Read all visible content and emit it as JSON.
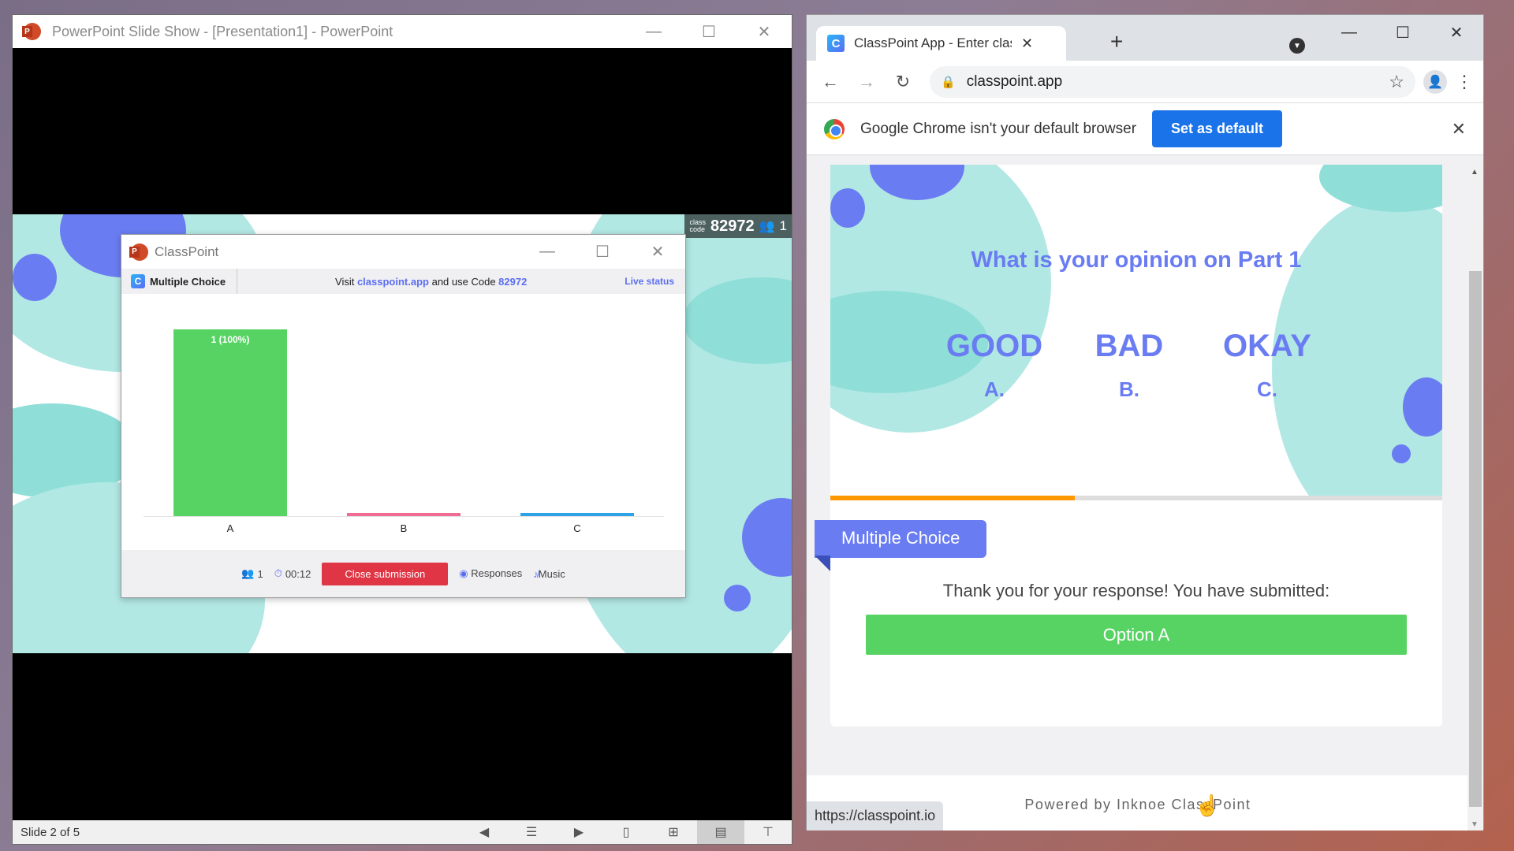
{
  "powerpoint": {
    "window_title": "PowerPoint Slide Show - [Presentation1] - PowerPoint",
    "window_controls": {
      "minimize": "—",
      "maximize": "☐",
      "close": "✕"
    },
    "class_code_badge": {
      "label_line1": "class",
      "label_line2": "code",
      "code": "82972",
      "participants": "1"
    },
    "status": {
      "slide_indicator": "Slide 2 of 5",
      "icons": [
        "previous-slide-icon",
        "notes-icon",
        "next-slide-icon",
        "normal-view-icon",
        "slide-sorter-icon",
        "reading-view-icon",
        "slideshow-icon"
      ],
      "active_view": "reading-view-icon"
    }
  },
  "classpoint_dialog": {
    "title": "ClassPoint",
    "question_type": "Multiple Choice",
    "visit_prefix": "Visit ",
    "visit_link": "classpoint.app",
    "visit_middle": " and use Code ",
    "visit_code": "82972",
    "live_status": "Live status",
    "footer": {
      "participants": "1",
      "timer": "00:12",
      "close_submission": "Close submission",
      "responses": "Responses",
      "music": "Music"
    }
  },
  "chart_data": {
    "type": "bar",
    "title": "",
    "xlabel": "",
    "ylabel": "",
    "categories": [
      "A",
      "B",
      "C"
    ],
    "values": [
      1,
      0,
      0
    ],
    "data_labels": [
      "1 (100%)",
      "",
      ""
    ],
    "colors": [
      "#57d364",
      "#f06b91",
      "#2ea3e8"
    ],
    "ylim": [
      0,
      1
    ],
    "grid": false,
    "legend": "none"
  },
  "chrome": {
    "tab_title": "ClassPoint App - Enter class code",
    "tab_close": "✕",
    "new_tab": "+",
    "url": "classpoint.app",
    "infobar": {
      "message": "Google Chrome isn't your default browser",
      "button": "Set as default",
      "close": "✕"
    },
    "status_url": "https://classpoint.io"
  },
  "web_page": {
    "slide": {
      "question": "What is your opinion on Part 1",
      "options": [
        {
          "text": "GOOD",
          "letter": "A."
        },
        {
          "text": "BAD",
          "letter": "B."
        },
        {
          "text": "OKAY",
          "letter": "C."
        }
      ]
    },
    "progress_fraction": 0.4,
    "tag": "Multiple Choice",
    "thanks_message": "Thank you for your response! You have submitted:",
    "submitted_option": "Option A",
    "powered_by": "Powered by Inknoe ClassPoint"
  },
  "colors": {
    "accent": "#6a7cf2",
    "green": "#57d364",
    "close_red": "#df3545",
    "chrome_blue": "#1a73e8",
    "progress_orange": "#ff9800",
    "slide_teal": "#b2e8e4"
  }
}
